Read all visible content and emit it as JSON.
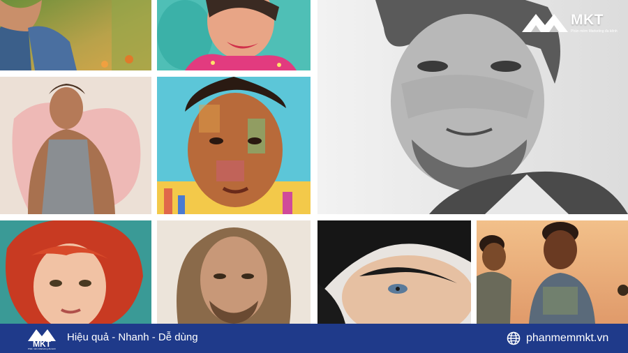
{
  "brand": {
    "name": "MKT",
    "tagline": "Phần mềm Marketing đa kênh"
  },
  "footer": {
    "slogan": "Hiệu quả - Nhanh - Dễ dùng",
    "website": "phanmemmkt.vn",
    "website_icon": "globe-icon"
  },
  "colors": {
    "footer_bg": "#1f3a8a",
    "text": "#ffffff"
  },
  "collage": {
    "tiles": [
      "portrait-woman-forest",
      "portrait-smiling-girl",
      "portrait-man-tank-top",
      "portrait-colorful-pixel-boy",
      "portrait-man-pencil-sketch",
      "portrait-redhead-woman",
      "portrait-long-hair-man",
      "portrait-woman-close-up",
      "portrait-two-boys"
    ]
  }
}
